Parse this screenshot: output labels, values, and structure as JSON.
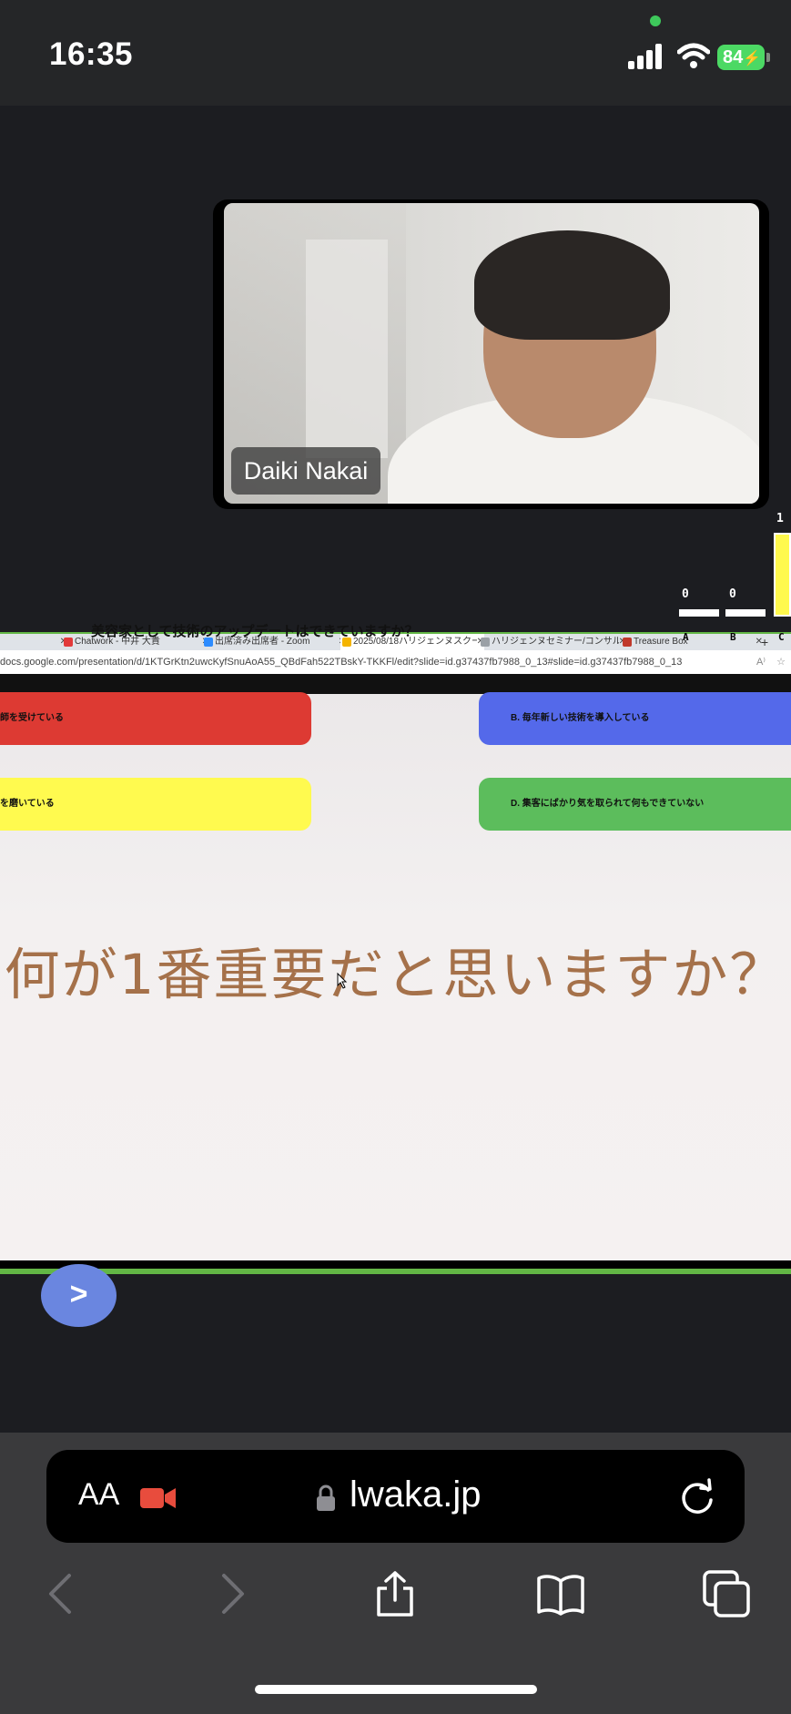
{
  "status": {
    "time": "16:35",
    "battery": "84"
  },
  "video": {
    "participant_name": "Daiki Nakai"
  },
  "scoreboard": {
    "top_label": "1",
    "left_count": "0",
    "right_count": "0",
    "column_labels": [
      "A",
      "B",
      "C"
    ]
  },
  "overlay_question": "美容家として技術のアップデートはできていますか？",
  "browser": {
    "tabs": [
      {
        "label": "Chatwork - 中井 大貴"
      },
      {
        "label": "出席済み出席者 - Zoom"
      },
      {
        "label": "2025/08/18ハリジェンヌスクール",
        "active": true
      },
      {
        "label": "ハリジェンヌセミナー/コンサル/受"
      },
      {
        "label": "Treasure Box"
      }
    ],
    "url": "docs.google.com/presentation/d/1KTGrKtn2uwcKyfSnuAoA55_QBdFah522TBskY-TKKFl/edit?slide=id.g37437fb7988_0_13#slide=id.g37437fb7988_0_13"
  },
  "slide": {
    "answers": {
      "a": "師を受けている",
      "b": "B. 毎年新しい技術を導入している",
      "c": "を磨いている",
      "d": "D. 集客にばかり気を取られて何もできていない"
    },
    "question": "何が1番重要だと思いますか？",
    "next_label": ">"
  },
  "safari": {
    "text_size_label": "AA",
    "url": "lwaka.jp"
  },
  "colors": {
    "answer_a": "#dd3a33",
    "answer_b": "#5469ea",
    "answer_c": "#fffa4f",
    "answer_d": "#5cbd5c",
    "question_text": "#a5714a",
    "accent_green": "#62b645"
  }
}
